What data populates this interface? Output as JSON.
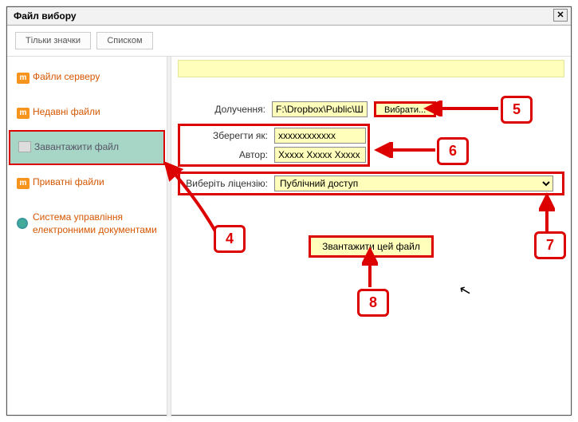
{
  "dialog": {
    "title": "Файл вибору"
  },
  "toolbar": {
    "icons_only": "Тільки значки",
    "list_view": "Списком"
  },
  "sidebar": {
    "items": [
      {
        "label": "Файли серверу"
      },
      {
        "label": "Недавні файли"
      },
      {
        "label": "Завантажити файл"
      },
      {
        "label": "Приватні файли"
      },
      {
        "label": "Система управління електронними документами"
      }
    ]
  },
  "form": {
    "attachment_label": "Долучення:",
    "attachment_value": "F:\\Dropbox\\Public\\Шк",
    "browse_label": "Вибрати...",
    "saveas_label": "Зберегти як:",
    "saveas_value": "xxxxxxxxxxxx",
    "author_label": "Автор:",
    "author_value": "Xxxxx Xxxxx Xxxxx",
    "license_label": "Виберіть ліцензію:",
    "license_value": "Публічний доступ",
    "upload_label": "Звантажити цей файл"
  },
  "callouts": {
    "c4": "4",
    "c5": "5",
    "c6": "6",
    "c7": "7",
    "c8": "8"
  }
}
